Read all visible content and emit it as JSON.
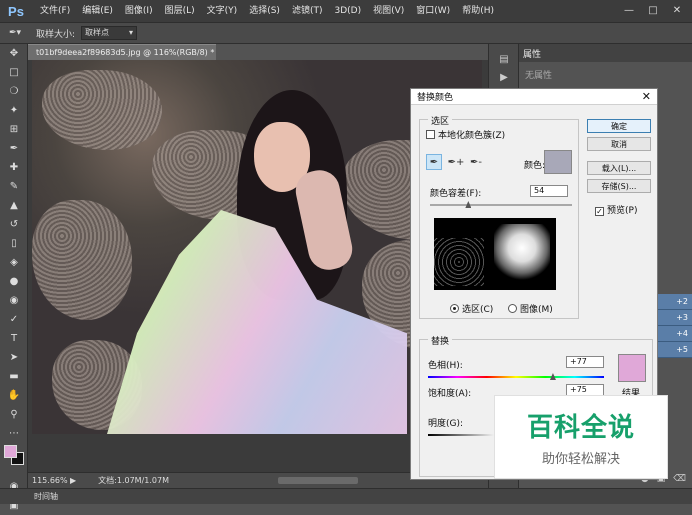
{
  "app": {
    "logo": "Ps"
  },
  "menu": [
    "文件(F)",
    "编辑(E)",
    "图像(I)",
    "图层(L)",
    "文字(Y)",
    "选择(S)",
    "滤镜(T)",
    "3D(D)",
    "视图(V)",
    "窗口(W)",
    "帮助(H)"
  ],
  "options": {
    "sample_label": "取样大小:",
    "sample_value": "取样点"
  },
  "document": {
    "tab_title": "t01bf9deea2f89683d5.jpg @ 116%(RGB/8) *",
    "zoom": "115.66%",
    "doc_info": "文档:1.07M/1.07M"
  },
  "timeline": {
    "label": "时间轴"
  },
  "properties": {
    "tab": "属性",
    "none_text": "无属性",
    "layer_labels": [
      "+2",
      "+3",
      "+4",
      "+5"
    ]
  },
  "dialog": {
    "title": "替换颜色",
    "selection_group": "选区",
    "localized_label": "本地化颜色簇(Z)",
    "color_label": "颜色:",
    "fuzziness_label": "颜色容差(F):",
    "fuzziness_value": "54",
    "fuzziness_fraction": 0.27,
    "radio_selection": "选区(C)",
    "radio_image": "图像(M)",
    "replace_group": "替换",
    "hue_label": "色相(H):",
    "hue_value": "+77",
    "hue_fraction": 0.71,
    "saturation_label": "饱和度(A):",
    "saturation_value": "+75",
    "lightness_label": "明度(G):",
    "result_label": "结果",
    "ok_button": "确定",
    "cancel_button": "取消",
    "load_button": "载入(L)...",
    "save_button": "存储(S)...",
    "preview_label": "预览(P)",
    "selection_color": "#a8a8b8",
    "result_color": "#e0a8d8"
  },
  "watermark": {
    "title": "百科全说",
    "subtitle": "助你轻松解决"
  }
}
